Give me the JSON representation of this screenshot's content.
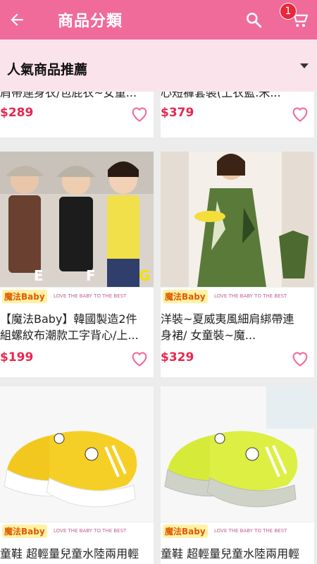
{
  "appbar": {
    "title": "商品分類",
    "cart_count": "1"
  },
  "category": {
    "selected": "人氣商品推薦"
  },
  "products": [
    {
      "name_line1": "肩帶連身衣/包屁衣~女童...",
      "price": "$289"
    },
    {
      "name_line1": "心短褲套裝(上衣藍.米...",
      "price": "$379"
    },
    {
      "name_line1": "【魔法Baby】韓國製造2件",
      "name_line2": "組螺紋布潮款工字背心/上...",
      "price": "$199",
      "labels": [
        "E",
        "F",
        "G"
      ]
    },
    {
      "name_line1": "洋裝~夏威夷風細肩綁帶連",
      "name_line2": "身裙/ 女童裝~魔...",
      "price": "$329"
    },
    {
      "name_line1": "童鞋 超輕量兒童水陸兩用輕"
    },
    {
      "name_line1": "童鞋 超輕量兒童水陸兩用輕"
    }
  ],
  "brand": {
    "logo": "魔法Baby",
    "tagline": "LOVE THE BABY TO THE BEST"
  },
  "colors": {
    "appbar": "#f06a9a",
    "category_bar": "#fbe3ec",
    "price": "#e8274f",
    "badge": "#e8273a"
  },
  "icons": [
    "back-arrow-icon",
    "search-icon",
    "cart-icon",
    "dropdown-caret-icon",
    "heart-icon"
  ]
}
